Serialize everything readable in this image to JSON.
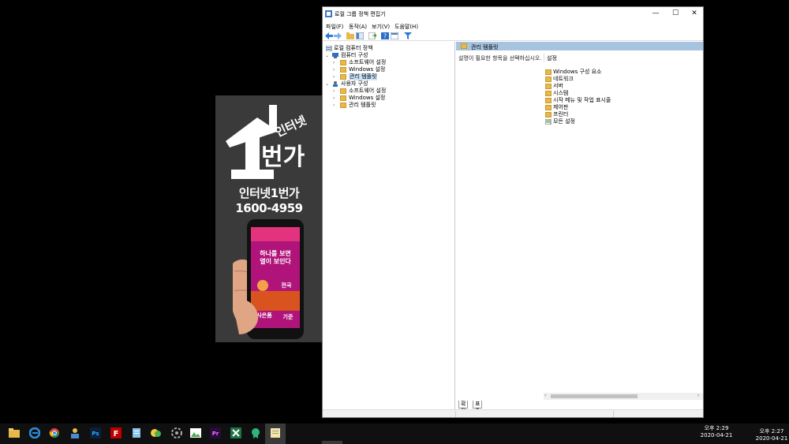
{
  "window": {
    "title": "로컬 그룹 정책 편집기",
    "controls": {
      "minimize": "—",
      "maximize": "☐",
      "close": "✕"
    }
  },
  "menu": {
    "file": "파일(F)",
    "action": "동작(A)",
    "view": "보기(V)",
    "help": "도움말(H)"
  },
  "tree": {
    "root": "로컬 컴퓨터 정책",
    "computer": "컴퓨터 구성",
    "computer_children": [
      "소프트웨어 설정",
      "Windows 설정",
      "관리 템플릿"
    ],
    "user": "사용자 구성",
    "user_children": [
      "소프트웨어 설정",
      "Windows 설정",
      "관리 템플릿"
    ]
  },
  "right": {
    "header": "관리 템플릿",
    "description": "설명이 필요한 항목을 선택하십시오.",
    "column": "설정",
    "items": [
      "Windows 구성 요소",
      "네트워크",
      "서버",
      "시스템",
      "시작 메뉴 및 작업 표시줄",
      "제어판",
      "프린터",
      "모든 설정"
    ]
  },
  "tabs": {
    "extended": "확장",
    "standard": "표준"
  },
  "banner": {
    "brand": "인터넷1번가",
    "phone": "1600-4959",
    "logo_text": "인터넷",
    "logo_main": "번가",
    "screen_text1": "하나를 보면",
    "screen_text2": "열이 보인다",
    "screen_text3": "전국",
    "screen_text4": "사은품",
    "screen_text5": "기준"
  },
  "taskbar": {
    "clock1_time": "오후 2:29",
    "clock1_date": "2020-04-21",
    "clock2_time": "오후 2:27",
    "clock2_date": "2020-04-21"
  },
  "colors": {
    "folder": "#e8b94a",
    "selection": "#cce4f7",
    "header": "#a6c3df",
    "banner_bg": "#3a3a3a"
  }
}
